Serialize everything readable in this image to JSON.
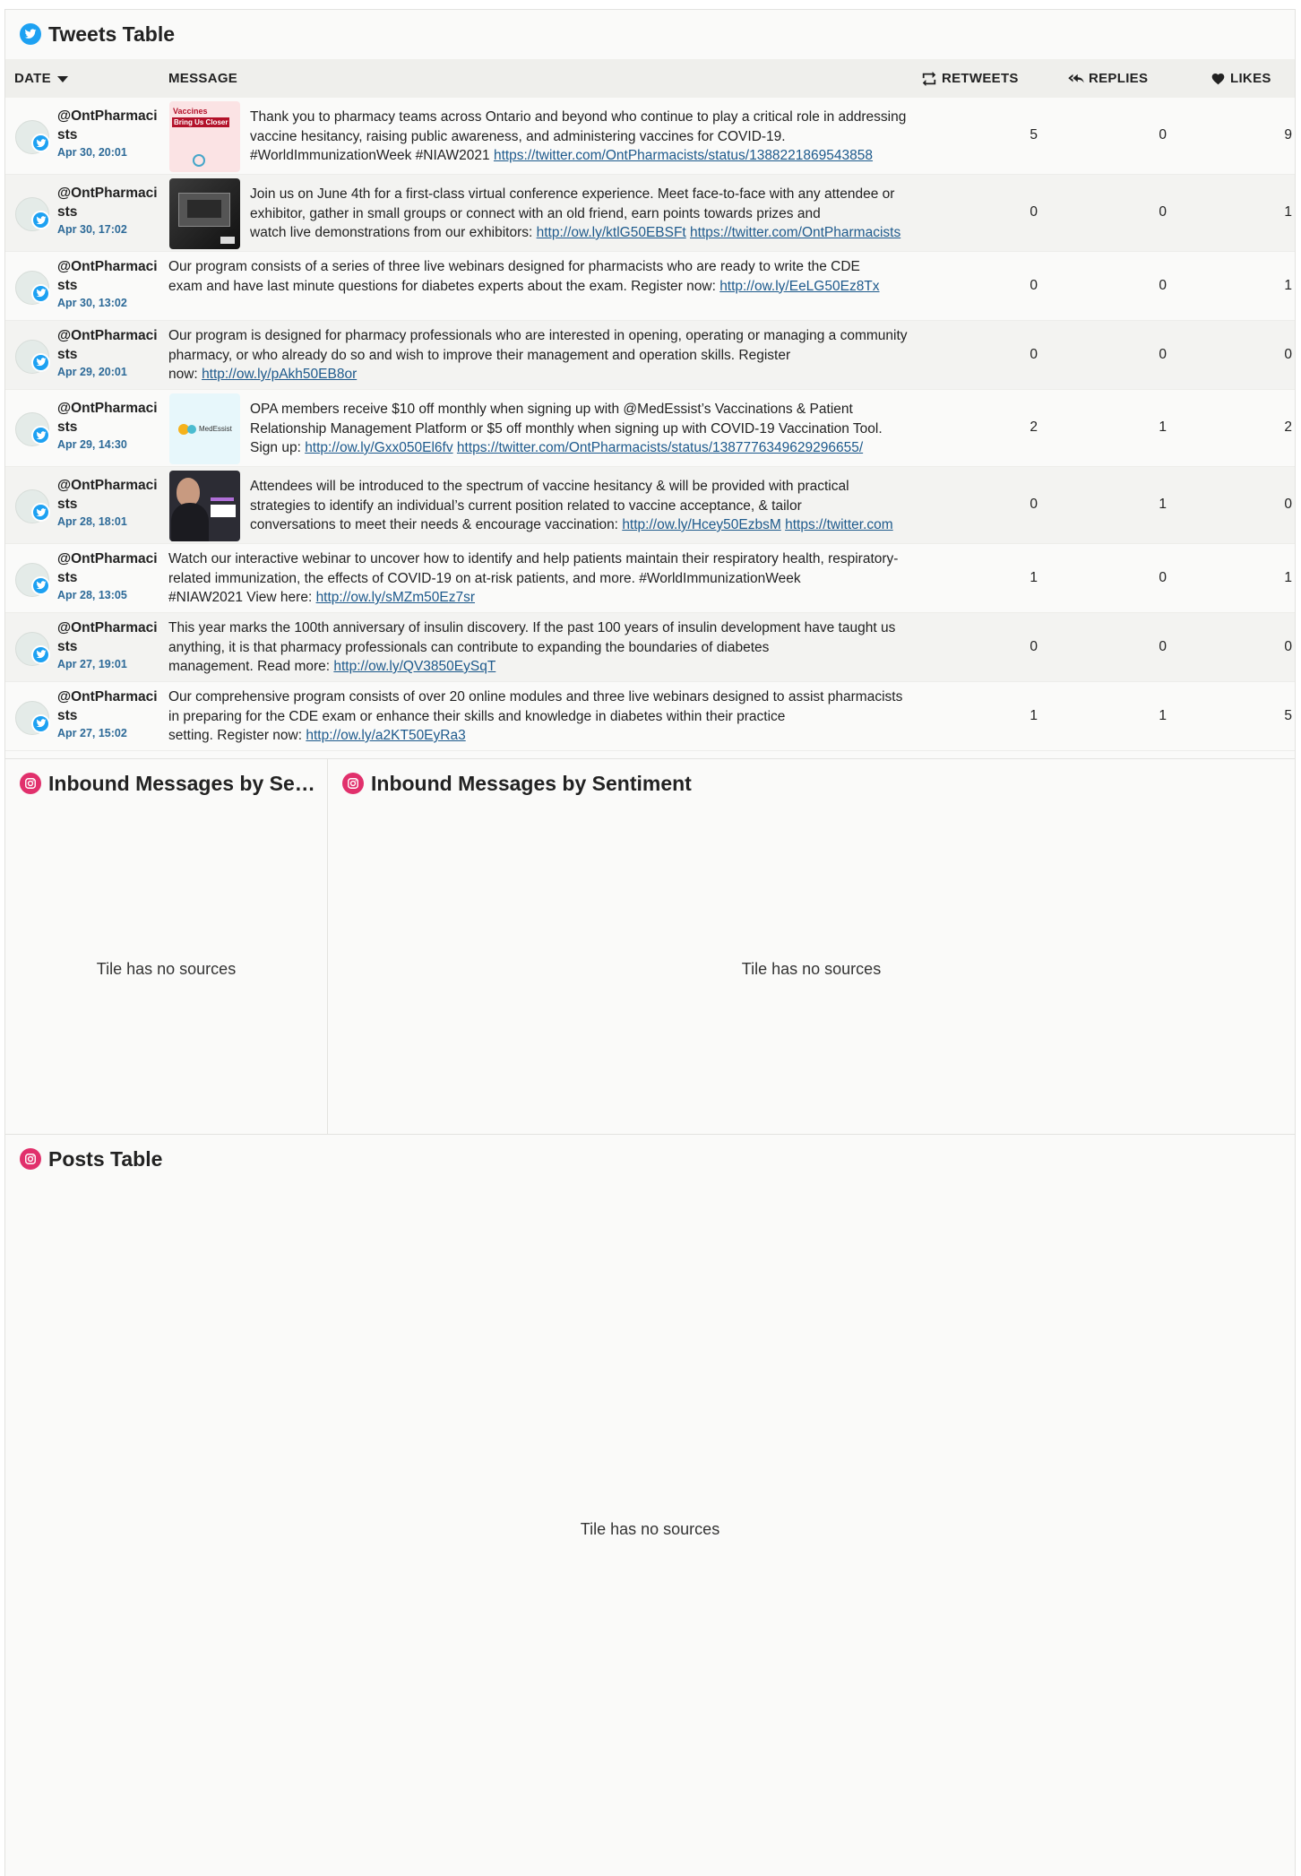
{
  "tweets_tile": {
    "title": "Tweets Table",
    "columns": {
      "date": "DATE",
      "message": "MESSAGE",
      "retweets": "RETWEETS",
      "replies": "REPLIES",
      "likes": "LIKES"
    },
    "rows": [
      {
        "handle": "@OntPharmacists",
        "date": "Apr 30, 20:01",
        "has_image": true,
        "image_kind": "vaccines-banner",
        "image_text": "Vaccines Bring Us Closer",
        "message": "Thank you to pharmacy teams across Ontario and beyond who continue to play a critical role in addressing vaccine hesitancy, raising public awareness, and administering vaccines for COVID-19.",
        "message_tail": "#WorldImmunizationWeek #NIAW2021 ",
        "link1": "https://twitter.com/OntPharmacists/status/1388221869543858",
        "link2": "",
        "retweets": "5",
        "replies": "0",
        "likes": "9"
      },
      {
        "handle": "@OntPharmacists",
        "date": "Apr 30, 17:02",
        "has_image": true,
        "image_kind": "dark-conference",
        "message": "Join us on June 4th for a first-class virtual conference experience. Meet face-to-face with any attendee or exhibitor, gather in small groups or connect with an old friend, earn points towards prizes and",
        "message_tail": "watch live demonstrations from our exhibitors: ",
        "link1": "http://ow.ly/ktlG50EBSFt",
        "link2": "https://twitter.com/OntPharmacists",
        "retweets": "0",
        "replies": "0",
        "likes": "1"
      },
      {
        "handle": "@OntPharmacists",
        "date": "Apr 30, 13:02",
        "has_image": false,
        "message": "Our program consists of a series of three live webinars designed for pharmacists who are ready to write the CDE",
        "message_tail": "exam and have last minute questions for diabetes experts about the exam. Register now: ",
        "link1": "http://ow.ly/EeLG50Ez8Tx",
        "link2": "",
        "retweets": "0",
        "replies": "0",
        "likes": "1"
      },
      {
        "handle": "@OntPharmacists",
        "date": "Apr 29, 20:01",
        "has_image": false,
        "message": "Our program is designed for pharmacy professionals who are interested in opening, operating or managing a community pharmacy, or who already do so and wish to improve their management and operation skills. Register",
        "message_tail": "now: ",
        "link1": "http://ow.ly/pAkh50EB8or",
        "link2": "",
        "retweets": "0",
        "replies": "0",
        "likes": "0"
      },
      {
        "handle": "@OntPharmacists",
        "date": "Apr 29, 14:30",
        "has_image": true,
        "image_kind": "medessist",
        "image_text": "MedEssist",
        "message": "OPA members receive $10 off monthly when signing up with @MedEssist’s Vaccinations & Patient Relationship Management Platform or $5 off monthly when signing up with COVID-19 Vaccination Tool.",
        "message_tail": "Sign up: ",
        "link1": "http://ow.ly/Gxx050El6fv",
        "link2": "https://twitter.com/OntPharmacists/status/1387776349629296655/",
        "retweets": "2",
        "replies": "1",
        "likes": "2"
      },
      {
        "handle": "@OntPharmacists",
        "date": "Apr 28, 18:01",
        "has_image": true,
        "image_kind": "portrait",
        "message": "Attendees will be introduced to the spectrum of vaccine hesitancy & will be provided with practical strategies to identify an individual’s current position related to vaccine acceptance, & tailor",
        "message_tail": "conversations to meet their needs & encourage vaccination: ",
        "link1": "http://ow.ly/Hcey50EzbsM",
        "link2": "https://twitter.com",
        "retweets": "0",
        "replies": "1",
        "likes": "0"
      },
      {
        "handle": "@OntPharmacists",
        "date": "Apr 28, 13:05",
        "has_image": false,
        "message": "Watch our interactive webinar to uncover how to identify and help patients maintain their respiratory health, respiratory-related immunization, the effects of COVID-19 on at-risk patients, and more. #WorldImmunizationWeek",
        "message_tail": "#NIAW2021 View here: ",
        "link1": "http://ow.ly/sMZm50Ez7sr",
        "link2": "",
        "retweets": "1",
        "replies": "0",
        "likes": "1"
      },
      {
        "handle": "@OntPharmacists",
        "date": "Apr 27, 19:01",
        "has_image": false,
        "message": "This year marks the 100th anniversary of insulin discovery. If the past 100 years of insulin development have taught us anything, it is that pharmacy professionals can contribute to expanding the boundaries of diabetes",
        "message_tail": "management. Read more: ",
        "link1": "http://ow.ly/QV3850EySqT",
        "link2": "",
        "retweets": "0",
        "replies": "0",
        "likes": "0"
      },
      {
        "handle": "@OntPharmacists",
        "date": "Apr 27, 15:02",
        "has_image": false,
        "message": "Our comprehensive program consists of over 20 online modules and three live webinars designed to assist pharmacists in preparing for the CDE exam or enhance their skills and knowledge in diabetes within their practice",
        "message_tail": "setting. Register now: ",
        "link1": "http://ow.ly/a2KT50EyRa3",
        "link2": "",
        "retweets": "1",
        "replies": "1",
        "likes": "5"
      }
    ]
  },
  "sentiment_small": {
    "title": "Inbound Messages by Sentiment",
    "empty": "Tile has no sources"
  },
  "sentiment_large": {
    "title": "Inbound Messages by Sentiment",
    "empty": "Tile has no sources"
  },
  "posts_tile": {
    "title": "Posts Table",
    "empty": "Tile has no sources"
  },
  "colors": {
    "twitter": "#1da1f2",
    "instagram": "#e1306c",
    "link": "#1e5a8c",
    "date": "#2d6a98"
  },
  "icons": {
    "tweets_header": "twitter-icon",
    "other_headers": "instagram-icon",
    "sort": "caret-down-icon",
    "retweets": "retweet-icon",
    "replies": "reply-all-icon",
    "likes": "heart-icon"
  }
}
